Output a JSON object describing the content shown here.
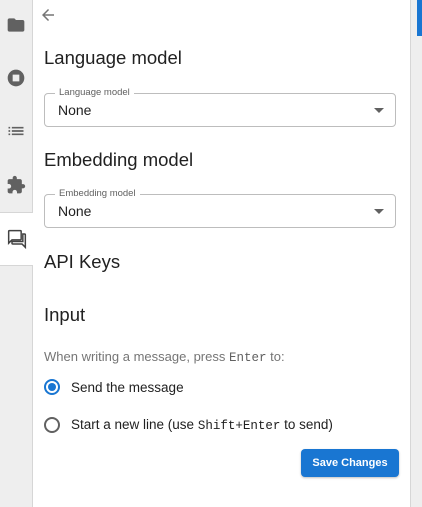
{
  "activity_bar": {
    "items": [
      {
        "icon": "folder-icon"
      },
      {
        "icon": "stop-circle-icon"
      },
      {
        "icon": "list-icon"
      },
      {
        "icon": "puzzle-icon"
      },
      {
        "icon": "chat-icon",
        "active": true
      }
    ]
  },
  "panel": {
    "back_icon": "arrow-left-icon",
    "language_model": {
      "title": "Language model",
      "field_label": "Language model",
      "value": "None"
    },
    "embedding_model": {
      "title": "Embedding model",
      "field_label": "Embedding model",
      "value": "None"
    },
    "api_keys": {
      "title": "API Keys"
    },
    "input": {
      "title": "Input",
      "hint_prefix": "When writing a message, press",
      "hint_key": "Enter",
      "hint_suffix": "to:",
      "option_send": "Send the message",
      "option_newline_prefix": "Start a new line (use",
      "option_newline_key": "Shift+Enter",
      "option_newline_suffix": "to send)",
      "selected": "send"
    },
    "save_label": "Save Changes"
  },
  "colors": {
    "accent": "#1976d2",
    "sidebar_bg": "#eeeeee"
  }
}
